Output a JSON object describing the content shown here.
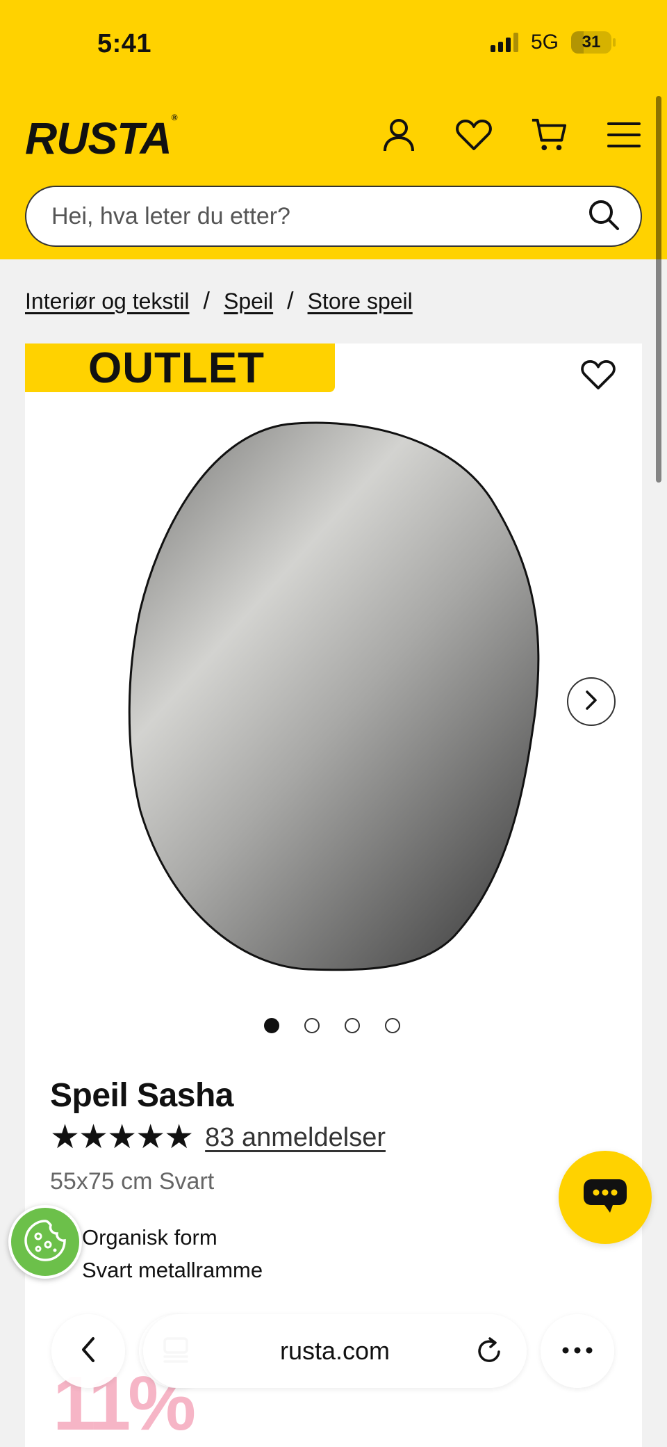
{
  "status_bar": {
    "time": "5:41",
    "network": "5G",
    "battery": "31",
    "battery_level": 0.31
  },
  "header": {
    "logo": "RUSTA",
    "logo_mark": "®"
  },
  "search": {
    "placeholder": "Hei, hva leter du etter?"
  },
  "icons": {
    "account": "user-icon",
    "wishlist": "heart-icon",
    "cart": "cart-icon",
    "menu": "hamburger-menu-icon",
    "search": "search-icon"
  },
  "breadcrumb": [
    "Interiør og tekstil",
    "Speil",
    "Store speil"
  ],
  "breadcrumb_separator": "/",
  "product": {
    "badge": "OUTLET",
    "name": "Speil Sasha",
    "stars": "★★★★★",
    "rating_value": 5,
    "reviews_label": "83 anmeldelser",
    "variant": "55x75 cm Svart",
    "features": [
      "Organisk form",
      "Svart metallramme"
    ],
    "gallery_images": 4,
    "gallery_active": 0
  },
  "browser": {
    "url": "rusta.com"
  },
  "promo": {
    "text": "11%"
  },
  "colors": {
    "brand_yellow": "#ffd200",
    "cookie_green": "#6cc04a",
    "text": "#111111",
    "muted": "#666666"
  }
}
